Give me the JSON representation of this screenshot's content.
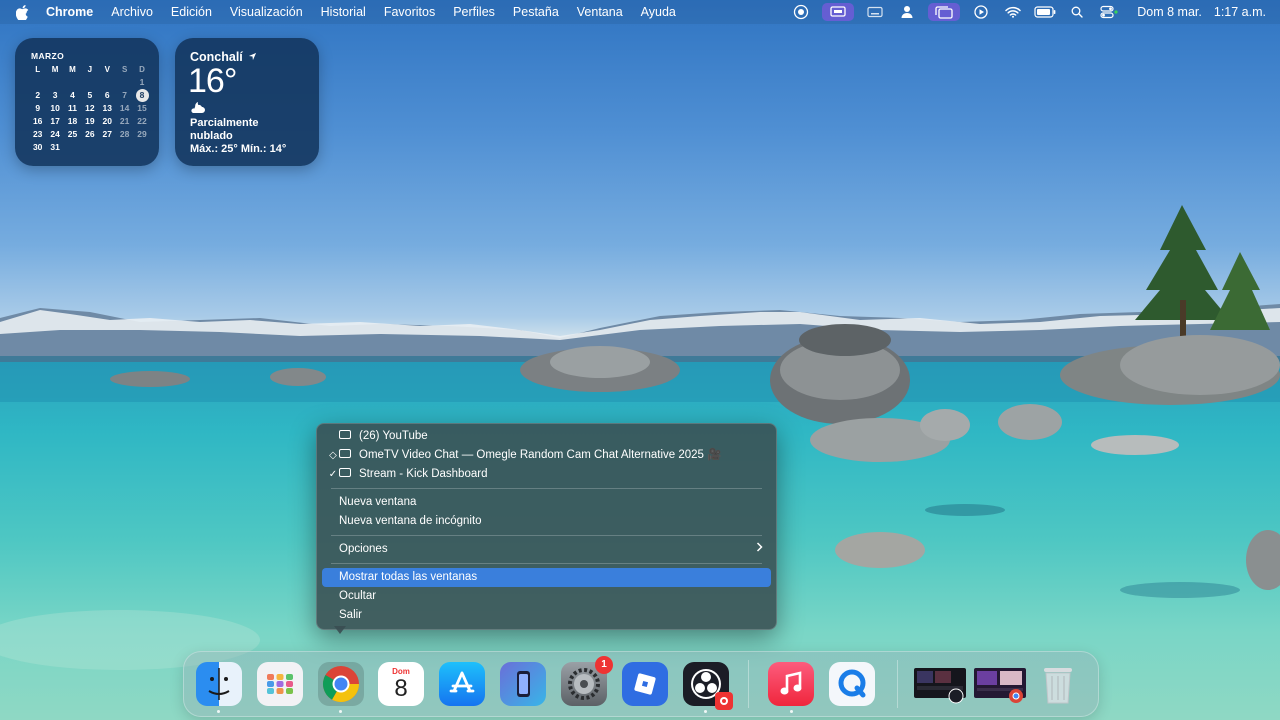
{
  "menubar": {
    "app_name": "Chrome",
    "menus": [
      "Archivo",
      "Edición",
      "Visualización",
      "Historial",
      "Favoritos",
      "Perfiles",
      "Pestaña",
      "Ventana",
      "Ayuda"
    ],
    "status_icons": [
      "screen-record-icon",
      "screen-mirroring-icon",
      "keyboard-icon",
      "user-icon",
      "stage-manager-icon",
      "play-icon",
      "wifi-icon",
      "battery-icon",
      "spotlight-search-icon",
      "control-center-icon"
    ],
    "date": "Dom 8 mar.",
    "time": "1:17 a.m."
  },
  "calendar_widget": {
    "month": "MARZO",
    "weekdays": [
      "L",
      "M",
      "M",
      "J",
      "V",
      "S",
      "D"
    ],
    "weeks": [
      [
        "",
        "",
        "",
        "",
        "",
        "",
        "1"
      ],
      [
        "2",
        "3",
        "4",
        "5",
        "6",
        "7",
        "8"
      ],
      [
        "9",
        "10",
        "11",
        "12",
        "13",
        "14",
        "15"
      ],
      [
        "16",
        "17",
        "18",
        "19",
        "20",
        "21",
        "22"
      ],
      [
        "23",
        "24",
        "25",
        "26",
        "27",
        "28",
        "29"
      ],
      [
        "30",
        "31",
        "",
        "",
        "",
        "",
        ""
      ]
    ],
    "today": "8"
  },
  "weather_widget": {
    "city": "Conchalí",
    "temperature": "16°",
    "condition_line1": "Parcialmente",
    "condition_line2": "nublado",
    "high_low": "Máx.: 25° Mín.: 14°"
  },
  "context_menu": {
    "windows": [
      {
        "title": "(26) YouTube",
        "mark": ""
      },
      {
        "title": "OmeTV Video Chat — Omegle Random Cam Chat Alternative 2025 🎥",
        "mark": "◇"
      },
      {
        "title": "Stream - Kick Dashboard",
        "mark": "✓"
      }
    ],
    "new_window": "Nueva ventana",
    "new_incognito": "Nueva ventana de incógnito",
    "options": "Opciones",
    "show_all": "Mostrar todas las ventanas",
    "hide": "Ocultar",
    "quit": "Salir"
  },
  "dock": {
    "apps": [
      "finder-icon",
      "launchpad-icon",
      "chrome-icon",
      "calendar-icon",
      "app-store-icon",
      "iphone-mirroring-icon",
      "system-settings-icon",
      "roblox-icon",
      "obs-icon",
      "music-icon",
      "quicktime-icon"
    ],
    "calendar_day_label": "Dom",
    "calendar_day_number": "8",
    "settings_badge": "1"
  },
  "colors": {
    "menu_highlight": "#3a7fdc",
    "widget_bg": "#12345c",
    "badge_red": "#e33333"
  }
}
